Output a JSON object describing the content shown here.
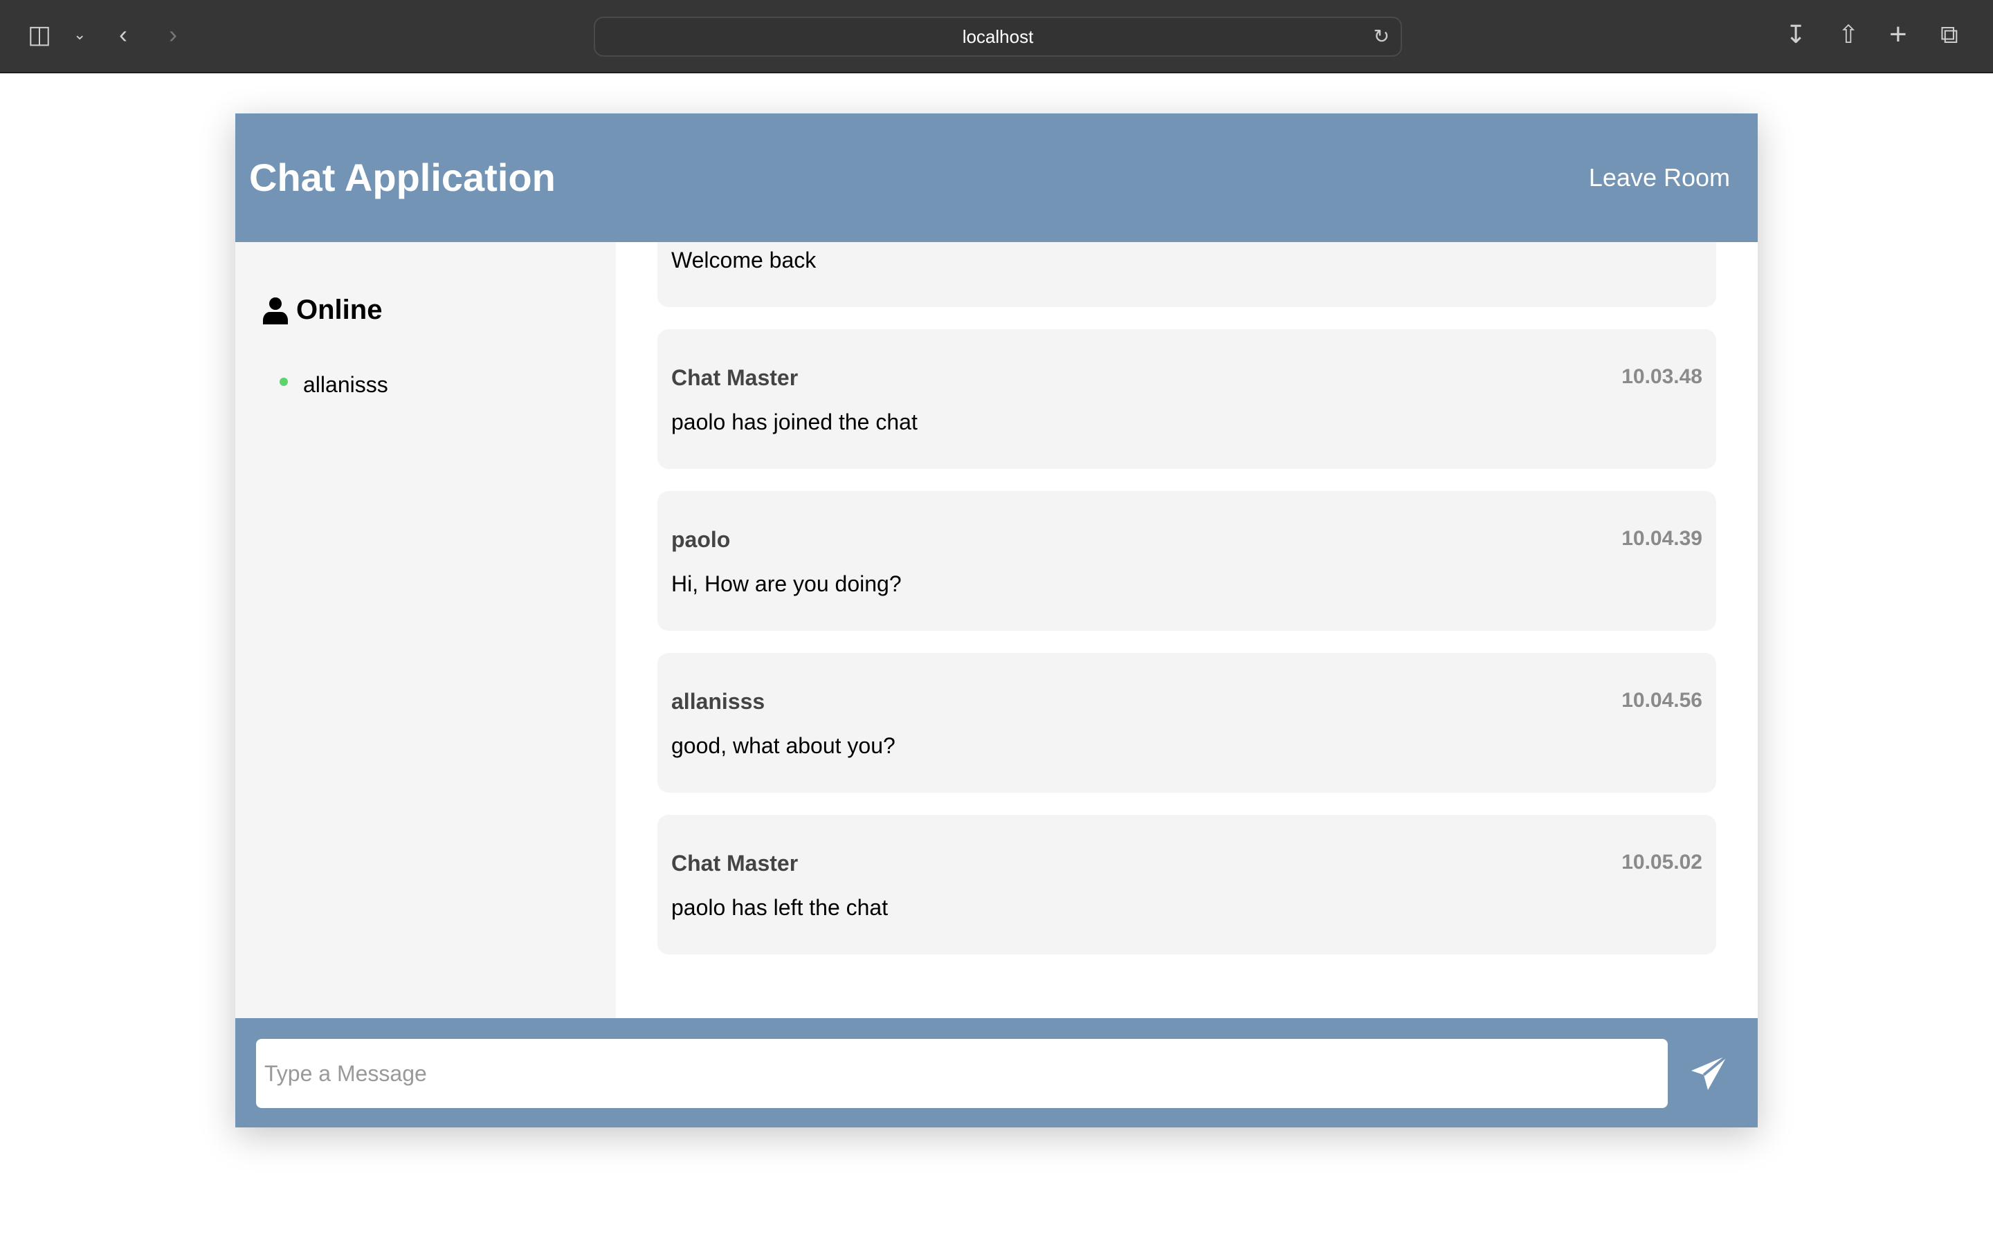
{
  "browser": {
    "url": "localhost"
  },
  "header": {
    "title": "Chat Application",
    "leave_label": "Leave Room"
  },
  "sidebar": {
    "heading": "Online",
    "users": [
      {
        "name": "allanisss",
        "status_color": "#5dd36c"
      }
    ]
  },
  "messages": [
    {
      "name": "",
      "time": "",
      "text": "Welcome back"
    },
    {
      "name": "Chat Master",
      "time": "10.03.48",
      "text": "paolo has joined the chat"
    },
    {
      "name": "paolo",
      "time": "10.04.39",
      "text": "Hi, How are you doing?"
    },
    {
      "name": "allanisss",
      "time": "10.04.56",
      "text": "good, what about you?"
    },
    {
      "name": "Chat Master",
      "time": "10.05.02",
      "text": "paolo has left the chat"
    }
  ],
  "composer": {
    "placeholder": "Type a Message",
    "value": ""
  },
  "colors": {
    "accent": "#7394b4",
    "online": "#5dd36c"
  }
}
